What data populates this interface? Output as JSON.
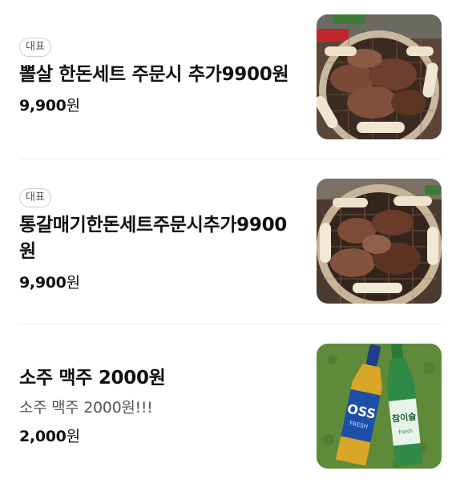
{
  "menu": {
    "items": [
      {
        "badge": "대표",
        "name": "뽈살 한돈세트 주문시 추가9900원",
        "price_number": "9,900",
        "price_unit": "원",
        "image_icon": "grilled-pork-photo"
      },
      {
        "badge": "대표",
        "name": "통갈매기한돈세트주문시추가9900원",
        "price_number": "9,900",
        "price_unit": "원",
        "image_icon": "grilled-pork-photo"
      },
      {
        "name": "소주 맥주 2000원",
        "description": "소주 맥주 2000원!!!",
        "price_number": "2,000",
        "price_unit": "원",
        "image_icon": "beer-soju-bottles-photo",
        "image_labels": {
          "beer": "OSS",
          "beer_sub": "FRESH",
          "soju": "참이슬",
          "soju_sub": "fresh"
        }
      }
    ]
  },
  "colors": {
    "text_primary": "#111111",
    "text_secondary": "#555555",
    "badge_border": "#cfcfcf",
    "divider": "#eeeeee",
    "grass_green": "#5e8a3a"
  }
}
